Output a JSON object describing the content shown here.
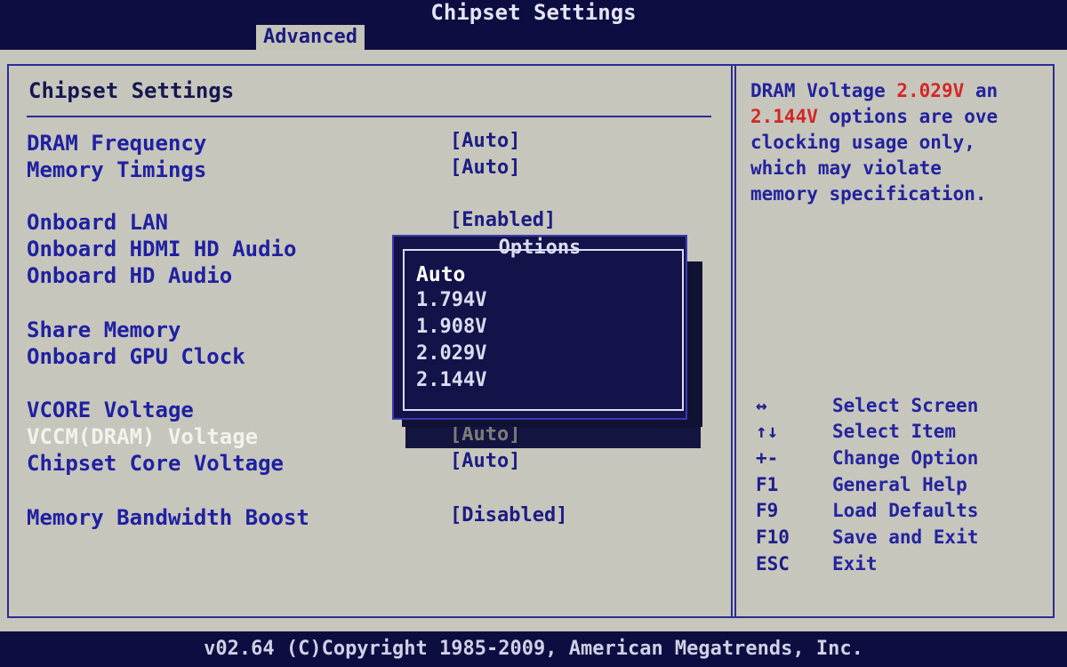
{
  "header": {
    "title": "Chipset Settings",
    "active_tab": "Advanced"
  },
  "main": {
    "section_title": "Chipset Settings",
    "settings": [
      {
        "label": "DRAM Frequency",
        "value": "[Auto]"
      },
      {
        "label": "Memory Timings",
        "value": "[Auto]"
      },
      {
        "label": "Onboard LAN",
        "value": "[Enabled]"
      },
      {
        "label": "Onboard HDMI HD Audio",
        "value": ""
      },
      {
        "label": "Onboard HD Audio",
        "value": ""
      },
      {
        "label": "Share Memory",
        "value": ""
      },
      {
        "label": "Onboard GPU Clock",
        "value": ""
      },
      {
        "label": "VCORE Voltage",
        "value": ""
      },
      {
        "label": "VCCM(DRAM) Voltage",
        "value": "[Auto]"
      },
      {
        "label": "Chipset Core Voltage",
        "value": "[Auto]"
      },
      {
        "label": "Memory Bandwidth Boost",
        "value": "[Disabled]"
      }
    ],
    "selected_setting": "VCCM(DRAM) Voltage"
  },
  "popup": {
    "title": "Options",
    "options": [
      "Auto",
      "1.794V",
      "1.908V",
      "2.029V",
      "2.144V"
    ],
    "highlighted": "Auto"
  },
  "help": {
    "line1_a": "DRAM Voltage ",
    "line1_b": "2.029V",
    "line1_c": " an",
    "line2_a": "2.144V",
    "line2_b": " options are ove",
    "line3": "clocking usage only,",
    "line4": "which may violate",
    "line5": "memory specification.",
    "accent_color": "#d42626"
  },
  "nav": [
    {
      "key": "↔",
      "desc": "Select Screen"
    },
    {
      "key": "↑↓",
      "desc": "Select Item"
    },
    {
      "key": "+-",
      "desc": "Change Option"
    },
    {
      "key": "F1",
      "desc": "General Help"
    },
    {
      "key": "F9",
      "desc": "Load Defaults"
    },
    {
      "key": "F10",
      "desc": "Save and Exit"
    },
    {
      "key": "ESC",
      "desc": "Exit"
    }
  ],
  "footer": {
    "text": "v02.64 (C)Copyright 1985-2009, American Megatrends, Inc."
  },
  "colors": {
    "background": "#0d0d42",
    "panel": "#c6c6bc",
    "text_blue": "#2020a2",
    "border": "#2c2c96"
  }
}
